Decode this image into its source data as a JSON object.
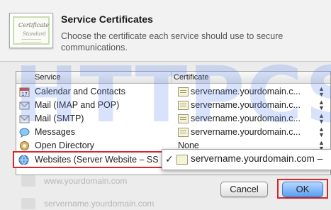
{
  "dialog": {
    "title": "Service Certificates",
    "subtitle": "Choose the certificate each service should use to secure communications."
  },
  "cert_art": {
    "line1": "Certificate",
    "line2": "Standard"
  },
  "table": {
    "headers": {
      "service": "Service",
      "certificate": "Certificate"
    },
    "rows": [
      {
        "service": "Calendar and Contacts",
        "certificate": "servername.yourdomain.c...",
        "icon": "calendar-icon"
      },
      {
        "service": "Mail (IMAP and POP)",
        "certificate": "servername.yourdomain.c...",
        "icon": "mail-icon"
      },
      {
        "service": "Mail (SMTP)",
        "certificate": "servername.yourdomain.c...",
        "icon": "mail-icon"
      },
      {
        "service": "Messages",
        "certificate": "servername.yourdomain.c...",
        "icon": "messages-icon"
      },
      {
        "service": "Open Directory",
        "certificate": "None",
        "icon": "open-directory-icon"
      }
    ],
    "selected_row": {
      "service": "Websites (Server Website – SS",
      "popup_check": "✓",
      "popup_certificate": "servername.yourdomain.com –"
    }
  },
  "background_rows": [
    "www.yourdomain.com",
    "servername.yourdomain.com"
  ],
  "buttons": {
    "cancel": "Cancel",
    "ok": "OK"
  },
  "watermark": "HTTPCS",
  "colors": {
    "highlight_outline": "#d6262e",
    "ok_button": "#5b9ef2"
  }
}
